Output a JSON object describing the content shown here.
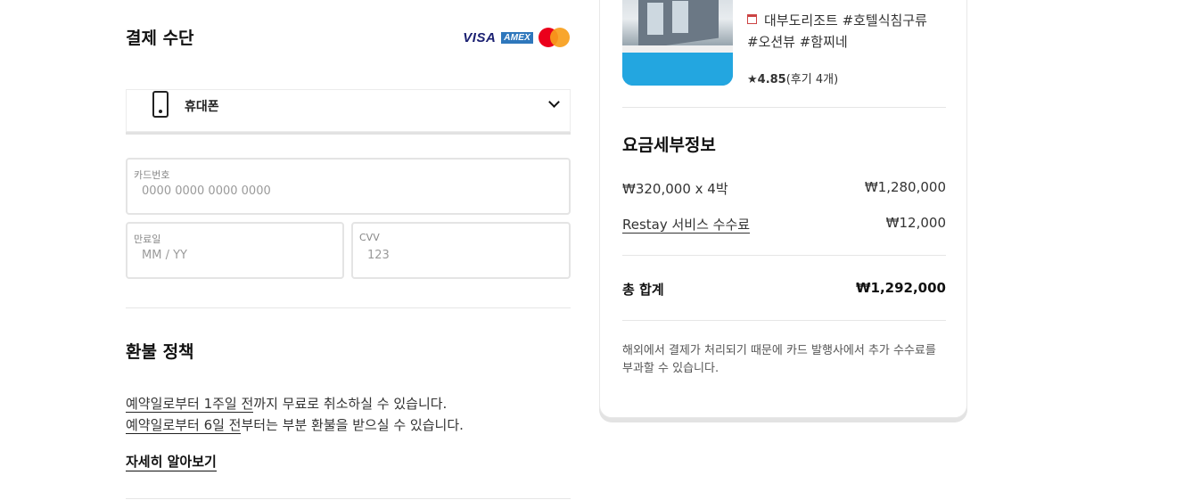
{
  "payment": {
    "title": "결제 수단",
    "card_logos": {
      "visa": "VISA",
      "amex": "AMEX"
    },
    "method_selected": "휴대폰",
    "fields": {
      "card_number": {
        "label": "카드번호",
        "placeholder": "0000 0000 0000 0000"
      },
      "expiry": {
        "label": "만료일",
        "placeholder": "MM / YY"
      },
      "cvv": {
        "label": "CVV",
        "placeholder": "123"
      }
    }
  },
  "refund": {
    "title": "환불 정책",
    "line1_link": "예약일로부터 1주일 전",
    "line1_rest": "까지 무료로 취소하실 수 있습니다.",
    "line2_link": "예약일로부터 6일 전",
    "line2_rest": "부터는 부분 환불을 받으실 수 있습니다.",
    "more_link": "자세히 알아보기"
  },
  "summary": {
    "stay_name_line1": "대부도리조트 #호텔식침구류",
    "stay_name_line2": "#오션뷰 #함찌네",
    "rating_value": "★4.85",
    "rating_reviews": "(후기 4개)",
    "fee_title": "요금세부정보",
    "nightly_label": "₩320,000 x 4박",
    "nightly_value": "₩1,280,000",
    "service_fee_label": "Restay 서비스 수수료",
    "service_fee_value": "₩12,000",
    "total_label": "총 합계",
    "total_value": "₩1,292,000",
    "notice": "해외에서 결제가 처리되기 때문에 카드 발행사에서 추가 수수료를 부과할 수 있습니다."
  },
  "colors": {
    "visa": "#1a1f71",
    "amex": "#2e77bc",
    "mastercard_red": "#eb001b",
    "mastercard_orange": "#f79e1b"
  }
}
